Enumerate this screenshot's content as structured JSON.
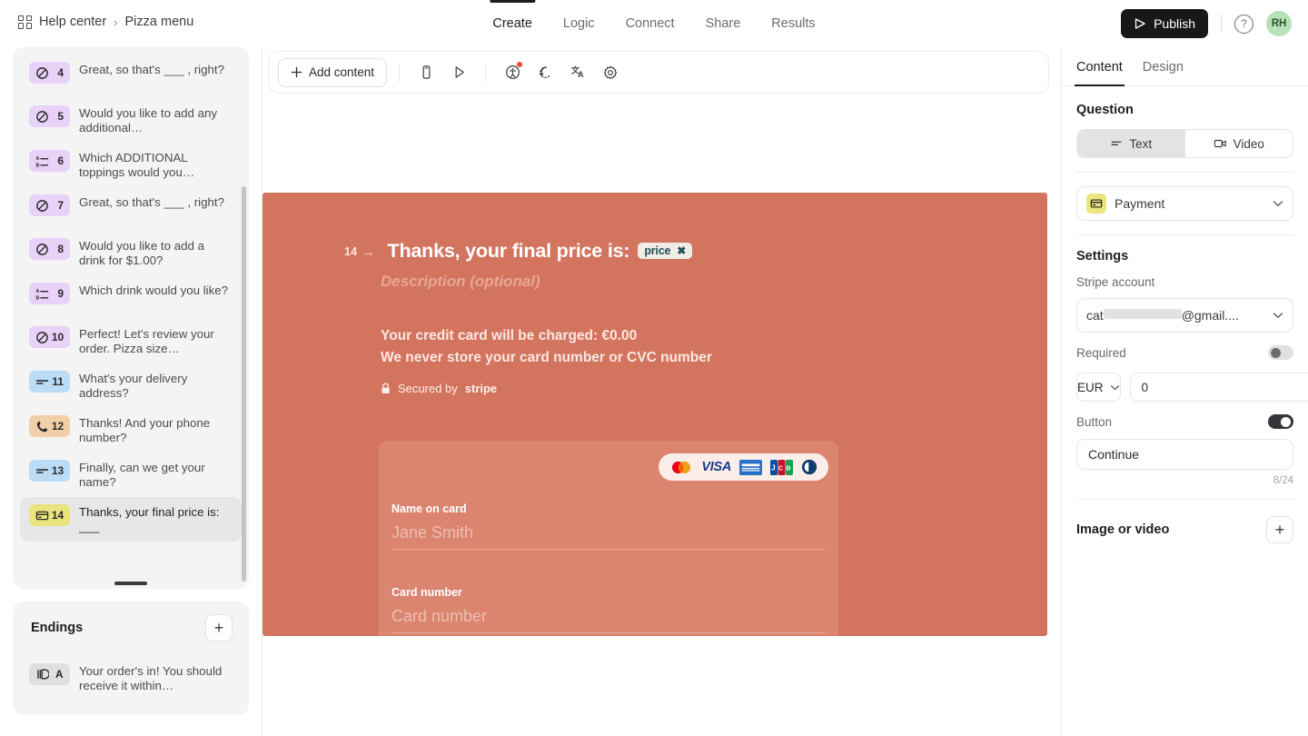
{
  "topbar": {
    "breadcrumb": {
      "icon": "grid-icon",
      "root": "Help center",
      "separator": "›",
      "current": "Pizza menu"
    },
    "nav_tabs": [
      {
        "label": "Create",
        "active": true
      },
      {
        "label": "Logic",
        "active": false
      },
      {
        "label": "Connect",
        "active": false
      },
      {
        "label": "Share",
        "active": false
      },
      {
        "label": "Results",
        "active": false
      }
    ],
    "publish_label": "Publish",
    "publish_icon": "publish-play-icon",
    "help_icon": "question-mark-icon",
    "help_glyph": "?",
    "avatar_initials": "RH",
    "avatar_color": "#b6e2b8"
  },
  "sidebar": {
    "questions": [
      {
        "num": "4",
        "icon": "no-entry-icon",
        "badge_color": "#e8d2f7",
        "text": "Great, so that's ___ , right?",
        "selected": false
      },
      {
        "num": "5",
        "icon": "no-entry-icon",
        "badge_color": "#e8d2f7",
        "text": "Would you like to add any additional…",
        "selected": false
      },
      {
        "num": "6",
        "icon": "multi-choice-icon",
        "badge_color": "#e8d2f7",
        "text": "Which ADDITIONAL toppings would you…",
        "selected": false
      },
      {
        "num": "7",
        "icon": "no-entry-icon",
        "badge_color": "#e8d2f7",
        "text": "Great, so that's ___ , right?",
        "selected": false
      },
      {
        "num": "8",
        "icon": "no-entry-icon",
        "badge_color": "#e8d2f7",
        "text": "Would you like to add a drink for $1.00?",
        "selected": false
      },
      {
        "num": "9",
        "icon": "multi-choice-icon",
        "badge_color": "#e8d2f7",
        "text": "Which drink would you like?",
        "selected": false
      },
      {
        "num": "10",
        "icon": "no-entry-icon",
        "badge_color": "#e8d2f7",
        "text": "Perfect! Let's review your order. Pizza size…",
        "selected": false
      },
      {
        "num": "11",
        "icon": "short-text-icon",
        "badge_color": "#bcdcf5",
        "text": "What's your delivery address?",
        "selected": false
      },
      {
        "num": "12",
        "icon": "phone-icon",
        "badge_color": "#f0d0a8",
        "text": "Thanks! And your phone number?",
        "selected": false
      },
      {
        "num": "13",
        "icon": "short-text-icon",
        "badge_color": "#bcdcf5",
        "text": "Finally, can we get your name?",
        "selected": false
      },
      {
        "num": "14",
        "icon": "payment-card-icon",
        "badge_color": "#ece47f",
        "text": "Thanks, your final price is: ___",
        "selected": true
      }
    ],
    "endings": {
      "title": "Endings",
      "add_label": "+",
      "items": [
        {
          "num": "A",
          "icon": "ending-door-icon",
          "text": "Your order's in! You should receive it within…"
        }
      ]
    }
  },
  "toolbar": {
    "add_content_label": "Add content",
    "add_content_icon": "plus-icon",
    "icons": [
      {
        "name": "mobile-preview-icon",
        "badge": false
      },
      {
        "name": "play-preview-icon",
        "badge": false
      },
      {
        "name": "accessibility-icon",
        "badge": true
      },
      {
        "name": "recall-information-icon",
        "badge": false
      },
      {
        "name": "translate-icon",
        "badge": false
      },
      {
        "name": "settings-gear-icon",
        "badge": false
      }
    ]
  },
  "canvas": {
    "background_color": "#d3745f",
    "panel_color": "#db8571",
    "question_number": "14",
    "arrow": "→",
    "title": "Thanks, your final price is:",
    "chip_label": "price",
    "chip_close": "✖",
    "description_placeholder": "Description (optional)",
    "charge_line1": "Your credit card will be charged: €0.00",
    "charge_line2": "We never store your card number or CVC number",
    "secured_prefix": "Secured by",
    "secured_brand": "stripe",
    "secured_icon": "lock-icon",
    "card_brands": [
      "mastercard-icon",
      "visa-icon",
      "amex-icon",
      "jcb-icon",
      "diners-icon"
    ],
    "fields": [
      {
        "label": "Name on card",
        "placeholder": "Jane Smith",
        "value": ""
      },
      {
        "label": "Card number",
        "placeholder": "Card number",
        "value": ""
      }
    ]
  },
  "right_panel": {
    "tabs": [
      {
        "label": "Content",
        "active": true
      },
      {
        "label": "Design",
        "active": false
      }
    ],
    "question_section_title": "Question",
    "question_type_toggle": [
      {
        "label": "Text",
        "icon": "text-lines-icon",
        "active": true
      },
      {
        "label": "Video",
        "icon": "video-camera-icon",
        "active": false
      }
    ],
    "field_type": {
      "label": "Payment",
      "icon": "payment-card-icon",
      "chevron": "⌄"
    },
    "settings_title": "Settings",
    "stripe_account_label": "Stripe account",
    "stripe_account_value_prefix": "cat",
    "stripe_account_value_suffix": "@gmail....",
    "required_label": "Required",
    "required_on": false,
    "currency": "EUR",
    "amount_value": "0",
    "button_label": "Button",
    "button_on": true,
    "button_text_value": "Continue",
    "button_counter": "8/24",
    "image_or_video_label": "Image or video",
    "image_or_video_add": "+"
  }
}
